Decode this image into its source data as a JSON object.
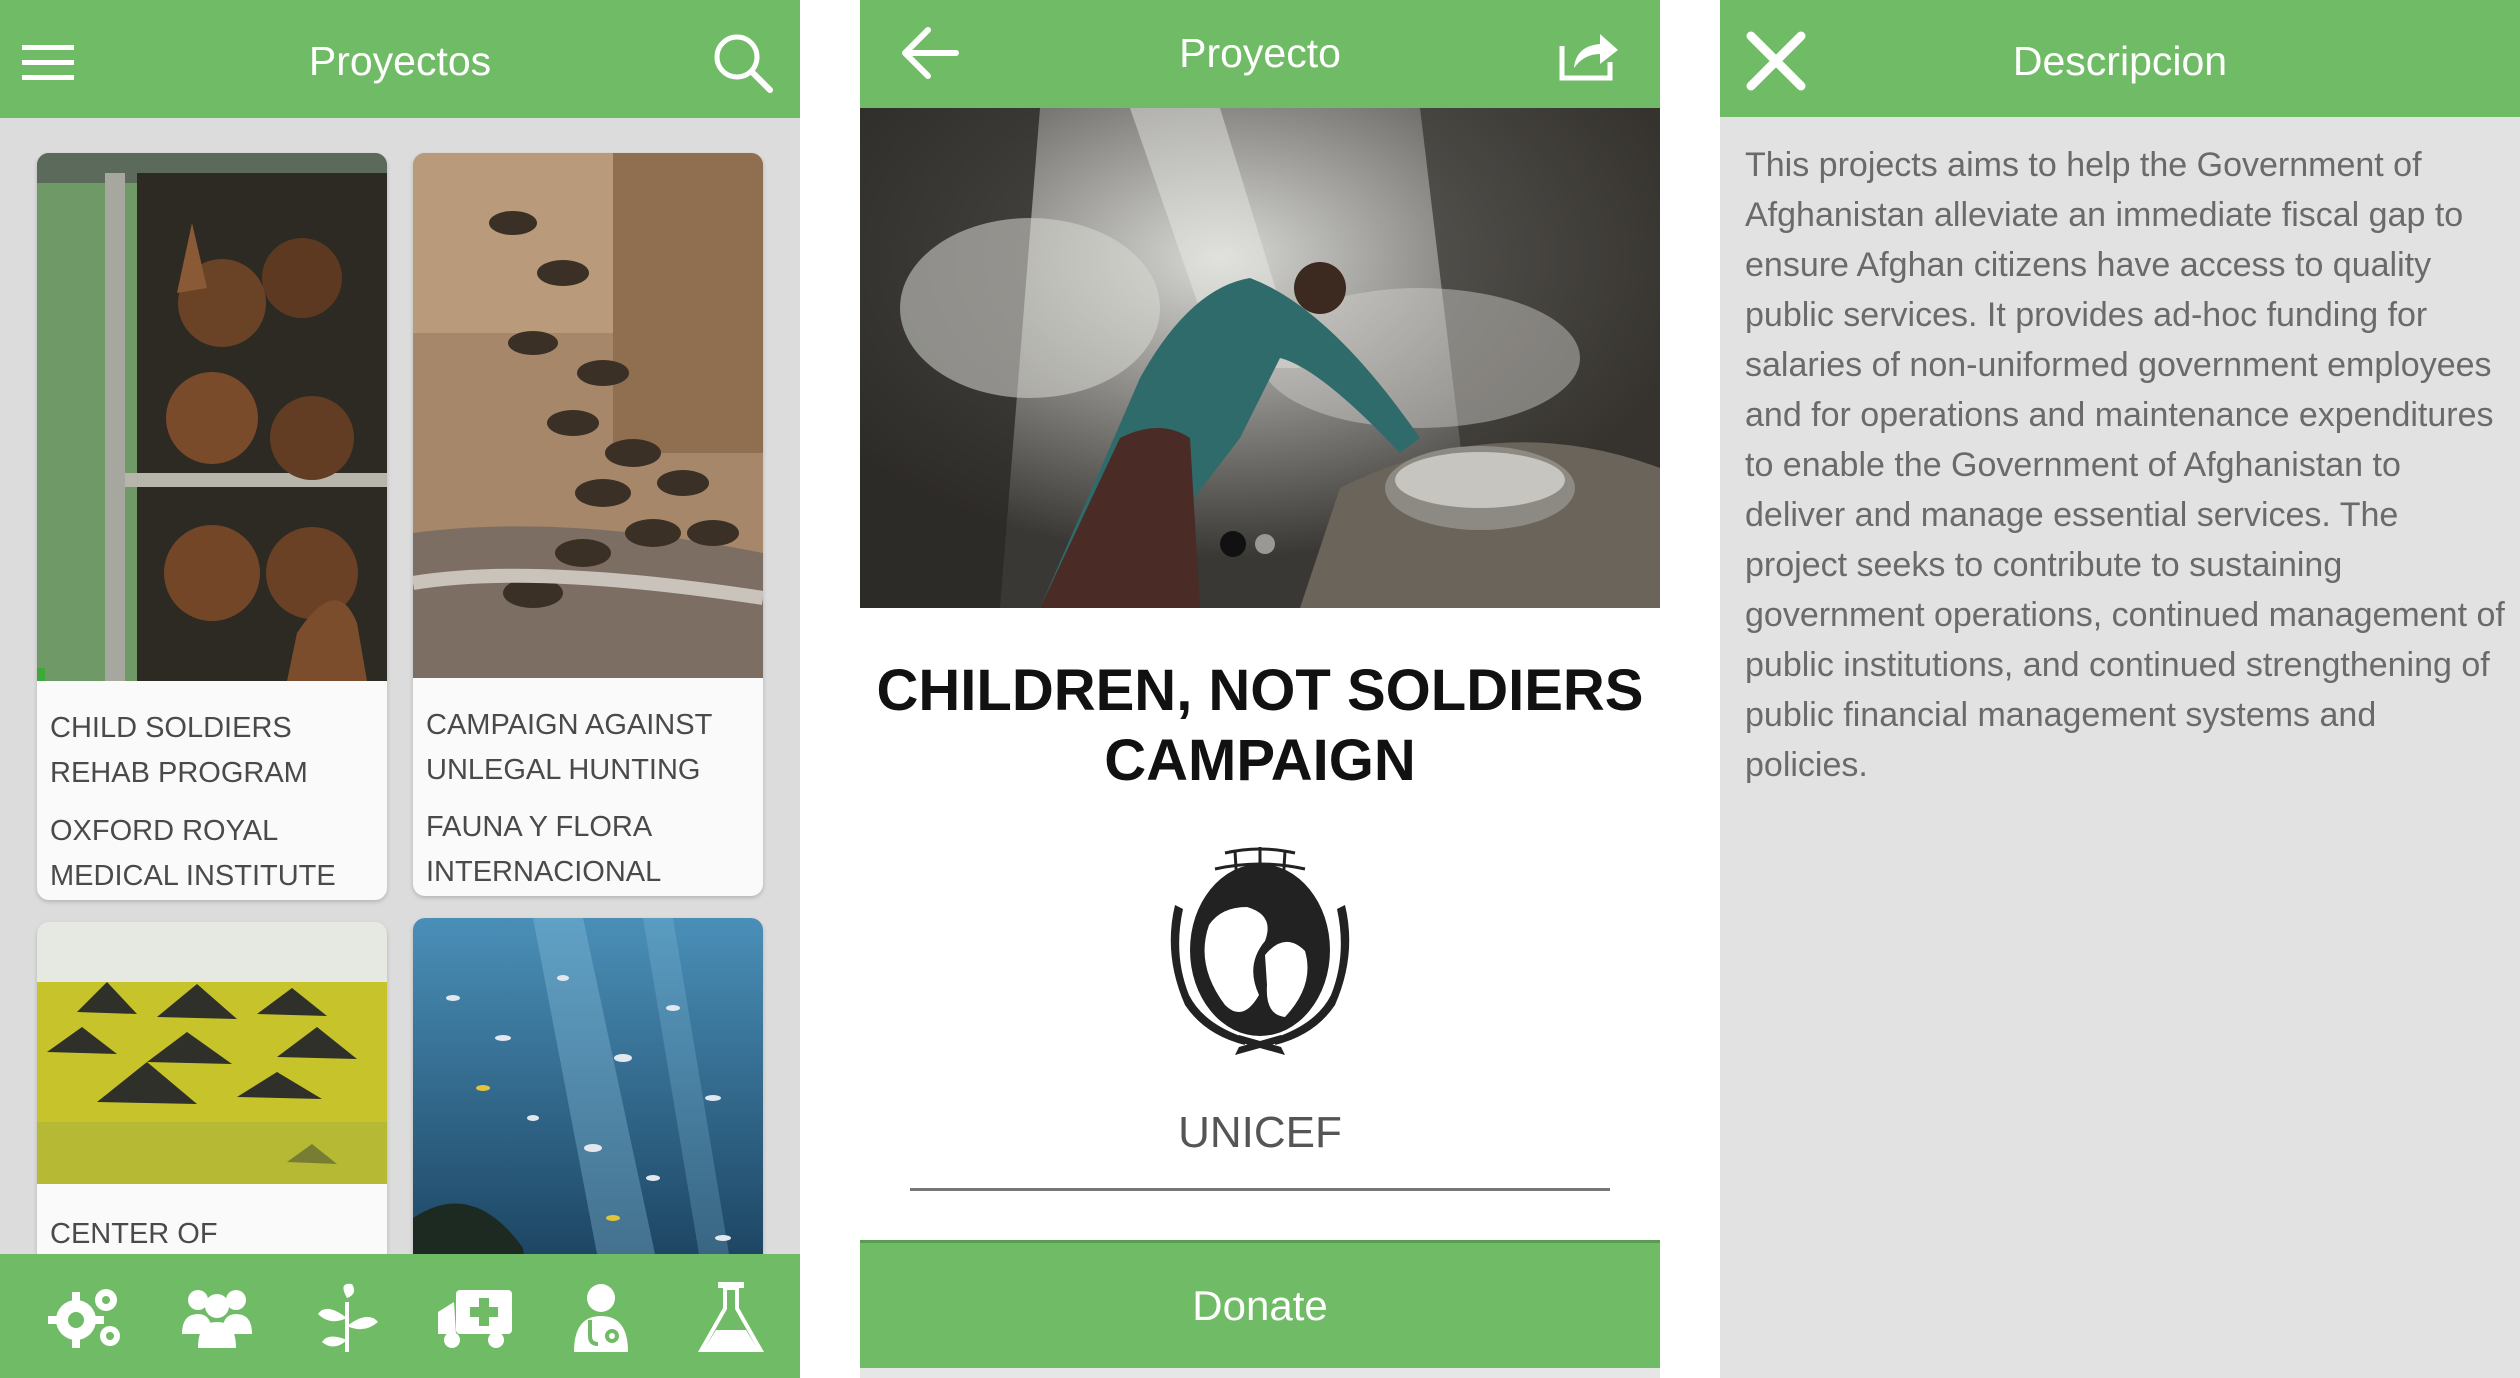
{
  "screens": {
    "list": {
      "title": "Proyectos",
      "cards": [
        {
          "line1": "CHILD SOLDIERS",
          "line2": "REHAB PROGRAM",
          "line3": "OXFORD ROYAL",
          "line4": "MEDICAL INSTITUTE"
        },
        {
          "line1": "CAMPAIGN AGAINST",
          "line2": "UNLEGAL HUNTING",
          "line3": "FAUNA Y FLORA",
          "line4": "INTERNACIONAL"
        },
        {
          "line1": "CENTER OF"
        },
        {}
      ],
      "bottom_icons": [
        "gears-icon",
        "group-icon",
        "plant-icon",
        "ambulance-icon",
        "doctor-icon",
        "flask-icon"
      ]
    },
    "detail": {
      "title": "Proyecto",
      "heading_line1": "CHILDREN, NOT SOLDIERS",
      "heading_line2": "CAMPAIGN",
      "org_name": "UNICEF",
      "donate_label": "Donate",
      "carousel_pages": 2,
      "carousel_active": 1
    },
    "description": {
      "title": "Descripcion",
      "text": "This projects aims to help the Government of Afghanistan alleviate an immediate fiscal gap to ensure Afghan citizens have access to quality public services. It provides ad-hoc funding for salaries of non-uniformed government employees and for operations and maintenance expenditures to enable the Government of Afghanistan to deliver and manage essential services. The project seeks to contribute to sustaining government operations, continued management of public institutions, and continued strengthening of public financial management systems and policies."
    }
  },
  "colors": {
    "accent": "#70bb65",
    "list_background": "#dcdcdc",
    "description_background": "#e2e2e2"
  }
}
